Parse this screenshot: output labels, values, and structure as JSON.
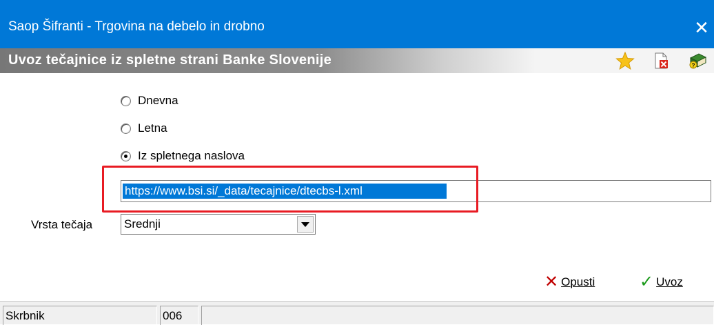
{
  "window": {
    "title": "Saop Šifranti - Trgovina na debelo in drobno",
    "close_symbol": "✕"
  },
  "subheader": {
    "title": "Uvoz tečajnice iz spletne strani Banke Slovenije",
    "icons": [
      "star-icon",
      "document-delete-icon",
      "book-help-icon"
    ]
  },
  "options": [
    {
      "label": "Dnevna",
      "checked": false
    },
    {
      "label": "Letna",
      "checked": false
    },
    {
      "label": "Iz spletnega naslova",
      "checked": true
    }
  ],
  "url_field": {
    "value": "https://www.bsi.si/_data/tecajnice/dtecbs-l.xml"
  },
  "rate_type": {
    "label": "Vrsta tečaja",
    "selected": "Srednji"
  },
  "buttons": {
    "cancel_label": "Opusti",
    "import_label": "Uvoz"
  },
  "statusbar": {
    "user": "Skrbnik",
    "code": "006",
    "extra": ""
  },
  "colors": {
    "titlebar": "#0078d7",
    "highlight": "#e81b23",
    "cancel_icon": "#c00000",
    "ok_icon": "#1a9a1a"
  }
}
